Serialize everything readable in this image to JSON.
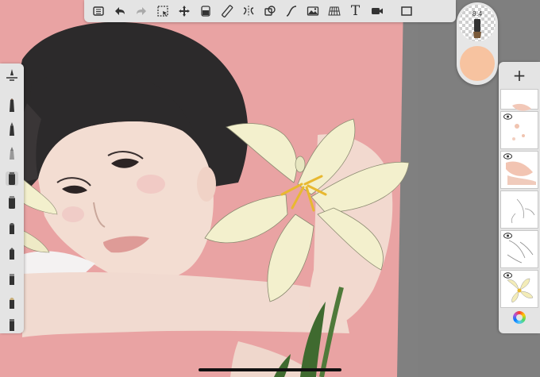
{
  "toolbar": {
    "tools": [
      {
        "name": "gallery-icon"
      },
      {
        "name": "undo-icon"
      },
      {
        "name": "redo-icon"
      },
      {
        "name": "selection-icon"
      },
      {
        "name": "transform-icon"
      },
      {
        "name": "fill-icon"
      },
      {
        "name": "ruler-icon"
      },
      {
        "name": "symmetry-icon"
      },
      {
        "name": "shapes-icon"
      },
      {
        "name": "curve-icon"
      },
      {
        "name": "image-icon"
      },
      {
        "name": "perspective-icon"
      },
      {
        "name": "text-icon"
      },
      {
        "name": "video-icon"
      },
      {
        "name": "fullscreen-icon"
      }
    ],
    "text_tool_label": "T"
  },
  "brush_puck": {
    "size_label": "8.4",
    "current_color": "#f7c3a0"
  },
  "layers_panel": {
    "add_label": "+",
    "layer_count": 6
  },
  "colors": {
    "canvas_bg": "#e9a3a3",
    "hair": "#2c2a2b",
    "skin": "#f3ddd2",
    "lily": "#f3f0cd",
    "stamen": "#e8b830"
  }
}
